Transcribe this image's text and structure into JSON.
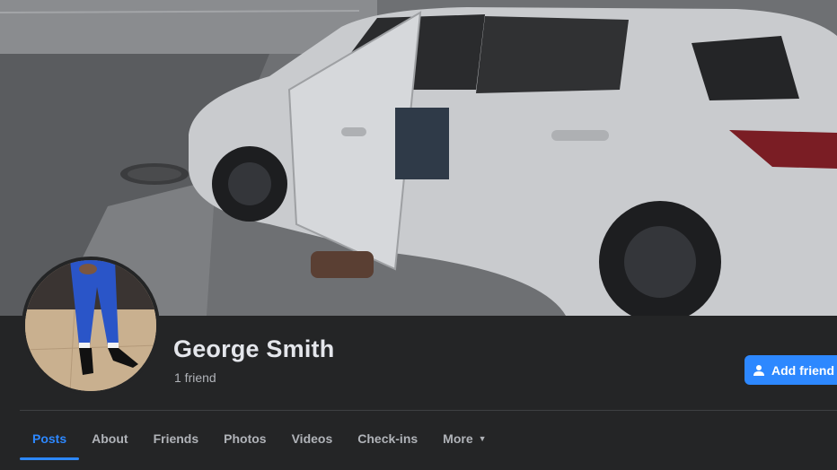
{
  "profile": {
    "name": "George Smith",
    "friends_count": "1 friend"
  },
  "actions": {
    "add_friend_label": "Add friend"
  },
  "tabs": [
    {
      "label": "Posts",
      "active": true
    },
    {
      "label": "About",
      "active": false
    },
    {
      "label": "Friends",
      "active": false
    },
    {
      "label": "Photos",
      "active": false
    },
    {
      "label": "Videos",
      "active": false
    },
    {
      "label": "Check-ins",
      "active": false
    },
    {
      "label": "More",
      "active": false
    }
  ],
  "icons": {
    "add_friend": "person-plus-icon",
    "more": "caret-down-icon"
  },
  "colors": {
    "accent": "#2d88ff",
    "background": "#242526",
    "text_primary": "#e4e6eb",
    "text_secondary": "#b0b3b8"
  }
}
